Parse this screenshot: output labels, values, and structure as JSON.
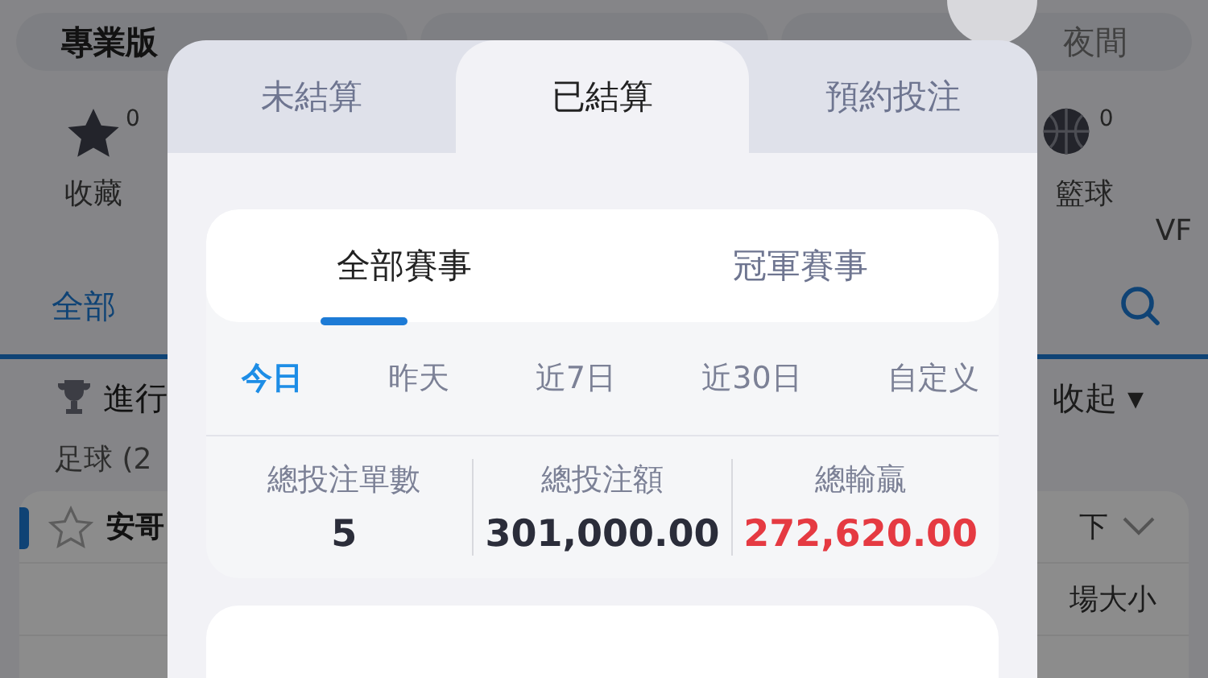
{
  "background": {
    "mode_tabs": [
      {
        "label": "專業版",
        "selected": true
      }
    ],
    "theme_tabs": [
      {
        "label": "夜間",
        "selected": false
      }
    ],
    "shortcuts": [
      {
        "kind": "star",
        "label": "收藏",
        "count": "0"
      },
      {
        "kind": "basketball",
        "label": "籃球",
        "count": "0"
      },
      {
        "kind": "text",
        "label": "VF"
      }
    ],
    "filter": {
      "label": "全部"
    },
    "section": {
      "title": "進行",
      "toggle": "收起",
      "toggle_icon": "▾"
    },
    "sport": "足球 (2",
    "rows": [
      {
        "name": "安哥",
        "right": "下",
        "bold": true
      },
      {
        "right": "場大小"
      }
    ]
  },
  "modal": {
    "tabs": [
      {
        "label": "未結算",
        "selected": false
      },
      {
        "label": "已結算",
        "selected": true
      },
      {
        "label": "預約投注",
        "selected": false
      }
    ],
    "scope_tabs": [
      {
        "label": "全部賽事",
        "selected": true
      },
      {
        "label": "冠軍賽事",
        "selected": false
      }
    ],
    "periods": [
      {
        "label": "今日",
        "selected": true
      },
      {
        "label": "昨天",
        "selected": false
      },
      {
        "label": "近7日",
        "selected": false
      },
      {
        "label": "近30日",
        "selected": false
      },
      {
        "label": "自定义",
        "selected": false
      }
    ],
    "stats": [
      {
        "label": "總投注單數",
        "value": "5",
        "kind": "plain"
      },
      {
        "label": "總投注額",
        "value": "301,000.00",
        "kind": "plain"
      },
      {
        "label": "總輸贏",
        "value": "272,620.00",
        "kind": "loss"
      }
    ]
  }
}
